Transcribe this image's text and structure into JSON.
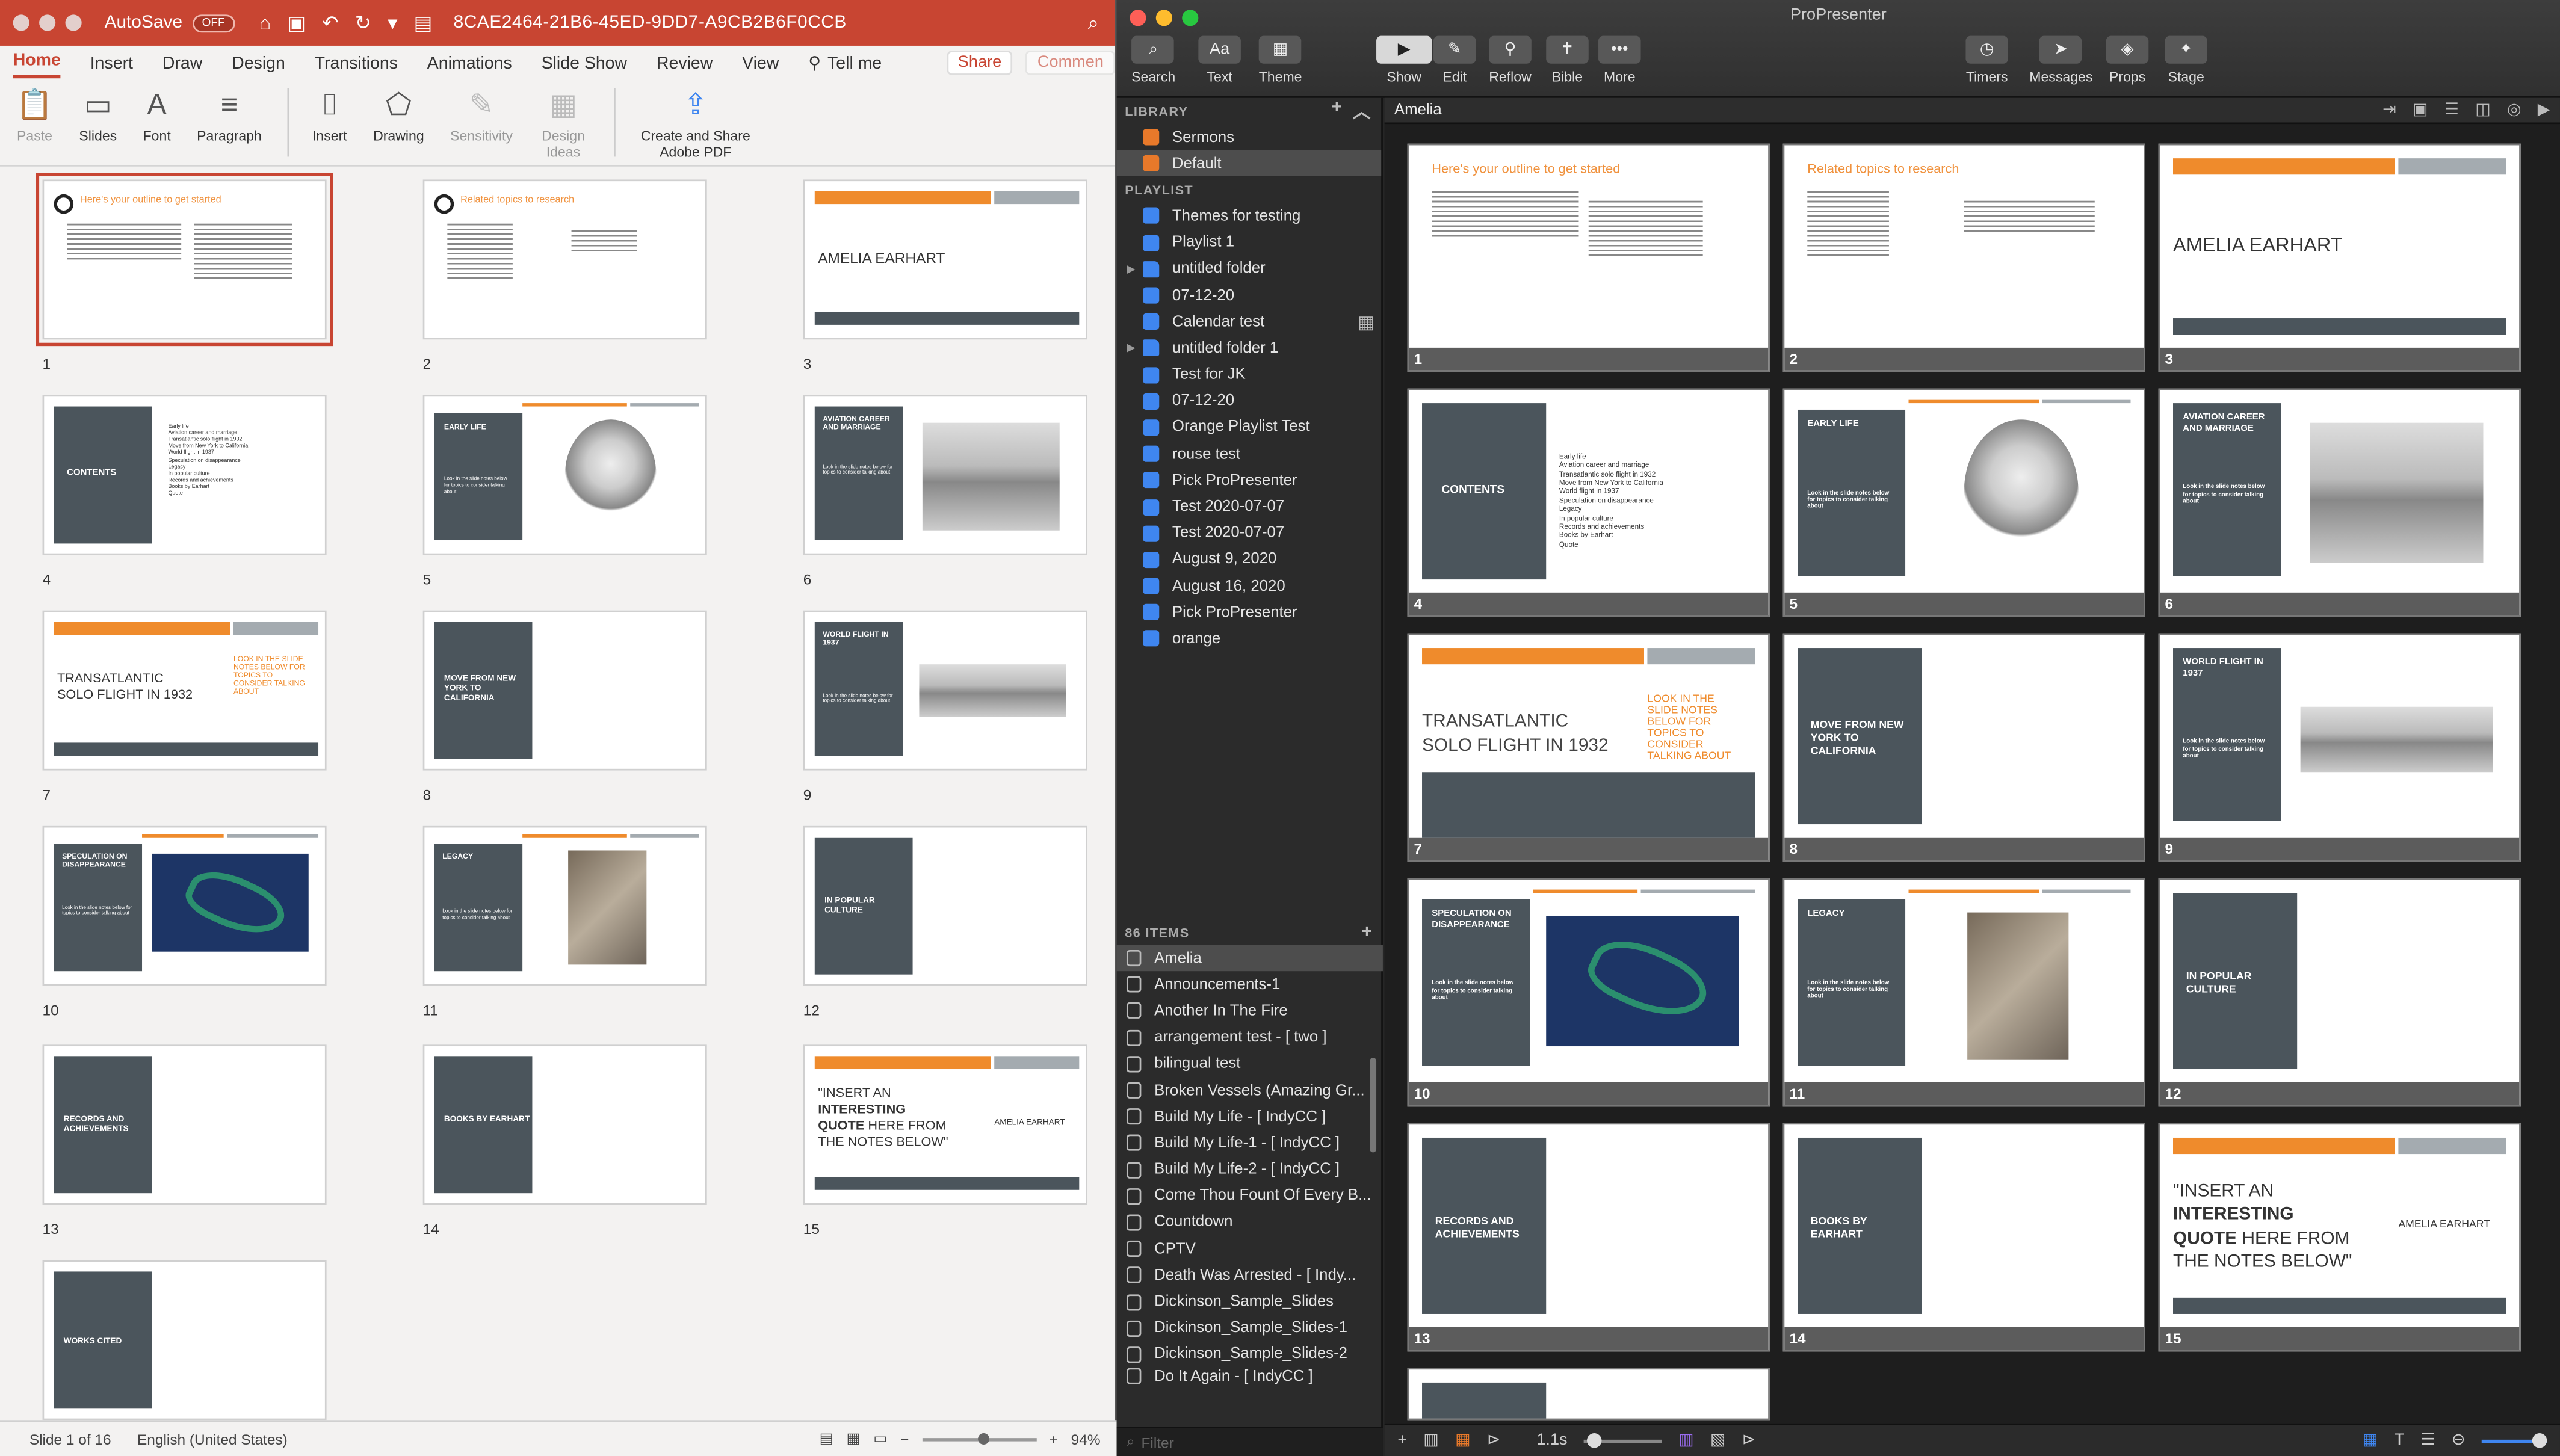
{
  "ppt": {
    "autosave_label": "AutoSave",
    "autosave_state": "OFF",
    "doc_name": "8CAE2464-21B6-45ED-9DD7-A9CB2B6F0CCB",
    "tabs": [
      "Home",
      "Insert",
      "Draw",
      "Design",
      "Transitions",
      "Animations",
      "Slide Show",
      "Review",
      "View"
    ],
    "tell_me": "Tell me",
    "share": "Share",
    "comments": "Commen",
    "groups": [
      "Paste",
      "Slides",
      "Font",
      "Paragraph",
      "Insert",
      "Drawing",
      "Sensitivity",
      "Design Ideas",
      "Create and Share Adobe PDF"
    ],
    "status_slide": "Slide 1 of 16",
    "status_lang": "English (United States)",
    "zoom": "94%",
    "thumb_numbers": [
      "1",
      "2",
      "3",
      "4",
      "5",
      "6",
      "7",
      "8",
      "9",
      "10",
      "11",
      "12",
      "13",
      "14",
      "15"
    ]
  },
  "slides": {
    "s1_title": "Here's your outline to get started",
    "s2_title": "Related topics to research",
    "s3_title": "AMELIA EARHART",
    "s4_title": "CONTENTS",
    "s4_bullets": [
      "Early life",
      "Aviation career and marriage",
      "Transatlantic solo flight in 1932",
      "Move from New York to California",
      "World flight in 1937",
      "Speculation on disappearance",
      "Legacy",
      "In popular culture",
      "Records and achievements",
      "Books by Earhart",
      "Quote"
    ],
    "s5_title": "EARLY LIFE",
    "s6_title": "AVIATION CAREER AND MARRIAGE",
    "s7_title_a": "TRANSATLANTIC",
    "s7_title_b": "SOLO FLIGHT IN 1932",
    "s7_note": "LOOK IN THE SLIDE NOTES BELOW FOR TOPICS TO CONSIDER TALKING ABOUT",
    "s8_title": "MOVE FROM NEW YORK TO CALIFORNIA",
    "s9_title": "WORLD FLIGHT IN 1937",
    "s10_title": "SPECULATION ON DISAPPEARANCE",
    "s11_title": "LEGACY",
    "s12_title": "IN POPULAR CULTURE",
    "s13_title": "RECORDS AND ACHIEVEMENTS",
    "s14_title": "BOOKS BY EARHART",
    "s15_quote_a": "\"INSERT AN",
    "s15_quote_b": "INTERESTING",
    "s15_quote_c": "QUOTE",
    "s15_quote_d": " HERE FROM",
    "s15_quote_e": "THE NOTES BELOW\"",
    "s15_author": "AMELIA EARHART",
    "s16_title": "WORKS CITED",
    "look_text": "Look in the slide notes below for topics to consider talking about"
  },
  "pro": {
    "window_title": "ProPresenter",
    "toolbar": [
      "Search",
      "Text",
      "Theme",
      "Show",
      "Edit",
      "Reflow",
      "Bible",
      "More",
      "Timers",
      "Messages",
      "Props",
      "Stage"
    ],
    "library_header": "LIBRARY",
    "library": [
      "Sermons",
      "Default"
    ],
    "playlist_header": "PLAYLIST",
    "playlists": [
      "Themes for testing",
      "Playlist 1",
      "untitled folder",
      "07-12-20",
      "Calendar test",
      "untitled folder 1",
      "Test for JK",
      "07-12-20",
      "Orange Playlist Test",
      "rouse test",
      "Pick ProPresenter",
      "Test 2020-07-07",
      "Test 2020-07-07",
      "August 9, 2020",
      "August 16, 2020",
      "Pick ProPresenter",
      "orange"
    ],
    "items_header": "86 ITEMS",
    "items": [
      "Amelia",
      "Announcements-1",
      "Another In The Fire",
      "arrangement test - [ two ]",
      "bilingual test",
      "Broken Vessels (Amazing Gr...",
      "Build My Life - [ IndyCC ]",
      "Build My Life-1 - [ IndyCC ]",
      "Build My Life-2 - [ IndyCC ]",
      "Come Thou Fount Of Every B...",
      "Countdown",
      "CPTV",
      "Death Was Arrested - [ Indy...",
      "Dickinson_Sample_Slides",
      "Dickinson_Sample_Slides-1",
      "Dickinson_Sample_Slides-2",
      "Do It Again - [ IndyCC ]"
    ],
    "filter_placeholder": "Filter",
    "presentation_name": "Amelia",
    "slide_labels": [
      "1",
      "2",
      "3",
      "4",
      "5",
      "6",
      "7",
      "8",
      "9",
      "10",
      "11",
      "12",
      "13",
      "14",
      "15"
    ],
    "transition_time": "1.1s"
  }
}
